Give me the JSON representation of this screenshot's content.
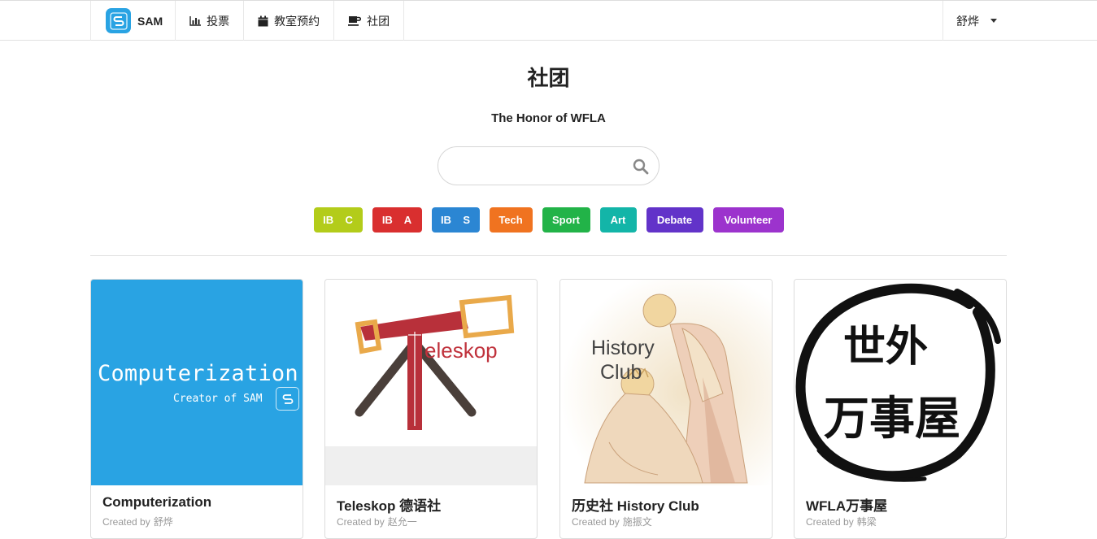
{
  "nav": {
    "brand": "SAM",
    "items": [
      {
        "label": "投票",
        "icon": "bar-chart-icon"
      },
      {
        "label": "教室预约",
        "icon": "calendar-icon"
      },
      {
        "label": "社团",
        "icon": "coffee-cup-icon"
      }
    ],
    "user": "舒烨"
  },
  "header": {
    "title": "社团",
    "subtitle": "The Honor of WFLA"
  },
  "search": {
    "placeholder": "",
    "value": ""
  },
  "tags": [
    {
      "label": "IB    C",
      "color": "#b3cc1a"
    },
    {
      "label": "IB    A",
      "color": "#d92f2f"
    },
    {
      "label": "IB    S",
      "color": "#2b86d3"
    },
    {
      "label": "Tech",
      "color": "#f07320"
    },
    {
      "label": "Sport",
      "color": "#22b348"
    },
    {
      "label": "Art",
      "color": "#13b5a8"
    },
    {
      "label": "Debate",
      "color": "#6233c9"
    },
    {
      "label": "Volunteer",
      "color": "#9c33cd"
    }
  ],
  "cards": [
    {
      "name": "Computerization",
      "created_by_label": "Created by",
      "creator": "舒烨",
      "image_title": "Computerization",
      "image_subtitle": "Creator of SAM"
    },
    {
      "name": "Teleskop 德语社",
      "created_by_label": "Created by",
      "creator": "赵允一",
      "image_text": "eleskop"
    },
    {
      "name": "历史社 History Club",
      "created_by_label": "Created by",
      "creator": "施振文",
      "image_text_1": "History",
      "image_text_2": "Club"
    },
    {
      "name": "WFLA万事屋",
      "created_by_label": "Created by",
      "creator": "韩梁",
      "image_text_1": "世外",
      "image_text_2": "万事屋"
    }
  ],
  "colors": {
    "accent": "#29a3e3"
  }
}
